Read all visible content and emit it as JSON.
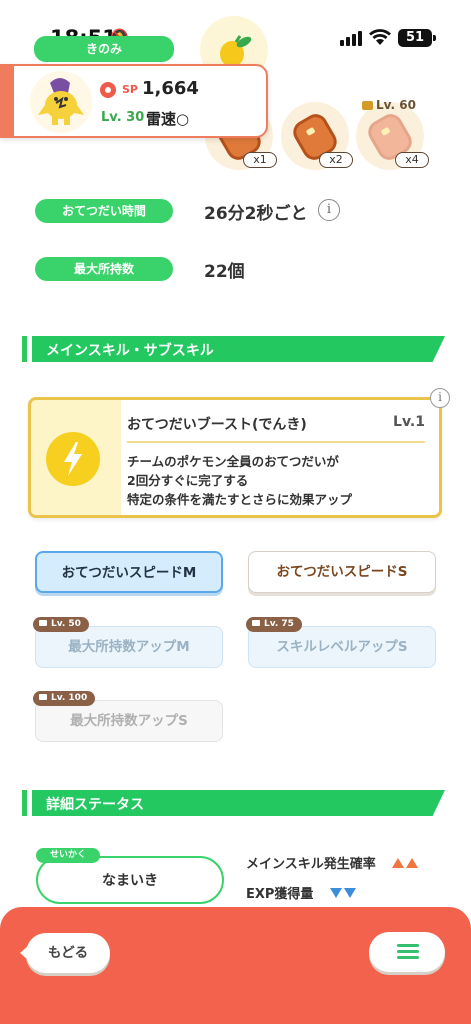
{
  "status": {
    "time": "18:51",
    "battery": "51"
  },
  "top": {
    "ingredient_label": "きのみ",
    "ingredients": [
      {
        "icon": "meat-icon",
        "multiplier": "x1"
      },
      {
        "icon": "meat-icon",
        "multiplier": "x2"
      },
      {
        "icon": "meat-icon",
        "multiplier": "x4",
        "lock_level": "Lv. 60"
      }
    ]
  },
  "pokemon": {
    "sp_label": "SP",
    "sp_value": "1,664",
    "level": "Lv. 30",
    "name": "雷速○"
  },
  "info": {
    "help_time_label": "おてつだい時間",
    "help_time_value": "26分2秒ごと",
    "max_carry_label": "最大所持数",
    "max_carry_value": "22個"
  },
  "sections": {
    "skills_title": "メインスキル・サブスキル",
    "details_title": "詳細ステータス"
  },
  "main_skill": {
    "name": "おてつだいブースト(でんき)",
    "level": "Lv.1",
    "desc_line1": "チームのポケモン全員のおてつだいが",
    "desc_line2": "2回分すぐに完了する",
    "desc_line3": "特定の条件を満たすとさらに効果アップ"
  },
  "sub_skills": [
    {
      "label": "おてつだいスピードM",
      "state": "active"
    },
    {
      "label": "おてつだいスピードS",
      "state": "unlocked"
    },
    {
      "label": "最大所持数アップM",
      "state": "locked",
      "lock_level": "Lv. 50"
    },
    {
      "label": "スキルレベルアップS",
      "state": "locked",
      "lock_level": "Lv. 75"
    },
    {
      "label": "最大所持数アップS",
      "state": "locked",
      "lock_level": "Lv. 100"
    }
  ],
  "nature": {
    "tag": "せいかく",
    "value": "なまいき",
    "up_label": "メインスキル発生確率",
    "down_label": "EXP獲得量"
  },
  "footer": {
    "back_label": "もどる"
  },
  "colors": {
    "accent_green": "#23c861",
    "footer_red": "#f2624c",
    "skill_gold": "#e9c34a",
    "active_blue": "#5aa8ec"
  }
}
